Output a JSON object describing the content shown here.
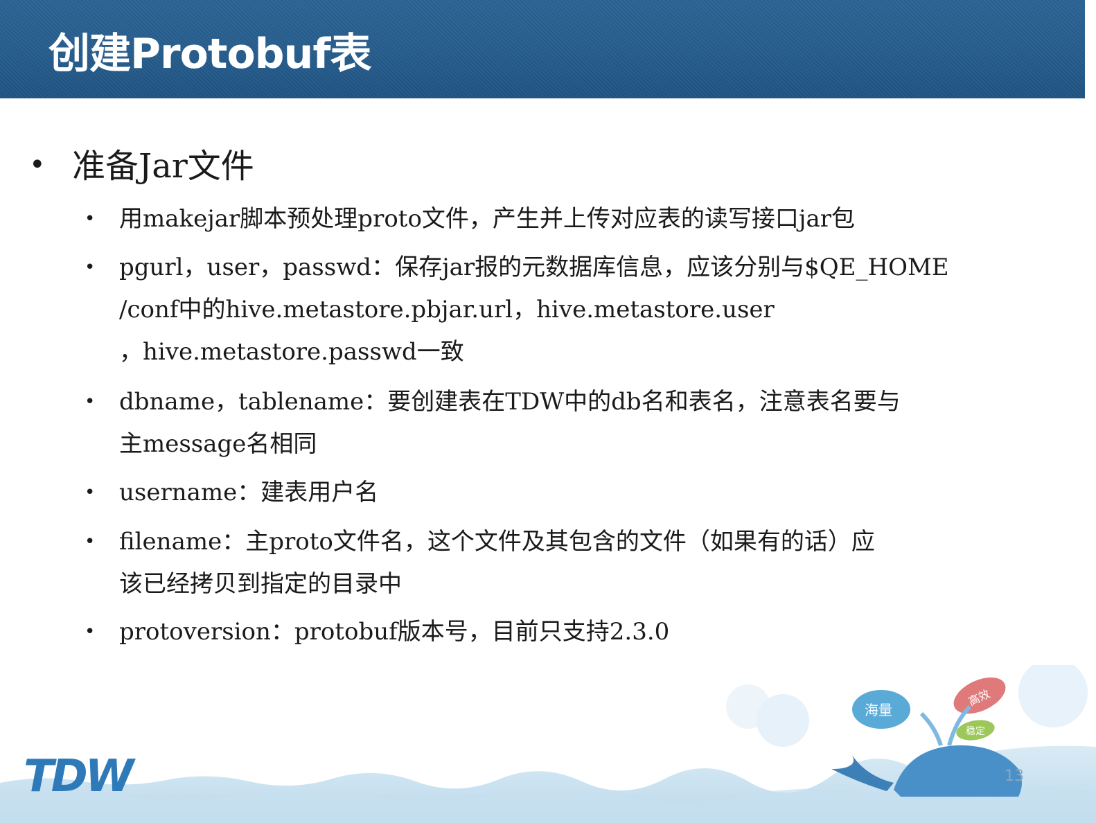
{
  "header": {
    "title": "创建Protobuf表"
  },
  "section": {
    "heading": "准备Jar文件"
  },
  "bullets": [
    {
      "lines": [
        "用makejar脚本预处理proto文件，产生并上传对应表的读写接口jar包"
      ]
    },
    {
      "lines": [
        "pgurl，user，passwd：保存jar报的元数据库信息，应该分别与$QE_HOME",
        "/conf中的hive.metastore.pbjar.url，hive.metastore.user",
        "，hive.metastore.passwd一致"
      ]
    },
    {
      "lines": [
        "dbname，tablename：要创建表在TDW中的db名和表名，注意表名要与",
        "主message名相同"
      ]
    },
    {
      "lines": [
        "username：建表用户名"
      ]
    },
    {
      "lines": [
        "filename：主proto文件名，这个文件及其包含的文件（如果有的话）应",
        "该已经拷贝到指定的目录中"
      ]
    },
    {
      "lines": [
        "protoversion：protobuf版本号，目前只支持2.3.0"
      ]
    }
  ],
  "logo": {
    "text": "TDW"
  },
  "decoration": {
    "drop_labels": [
      "海量",
      "高效",
      "稳定"
    ]
  },
  "footer": {
    "page_number": "13"
  },
  "colors": {
    "title_bar": "#255c8c",
    "logo": "#2e7ab8",
    "drop_blue": "#5aaad8",
    "drop_red": "#e07a7a",
    "drop_green": "#9cc85a"
  }
}
